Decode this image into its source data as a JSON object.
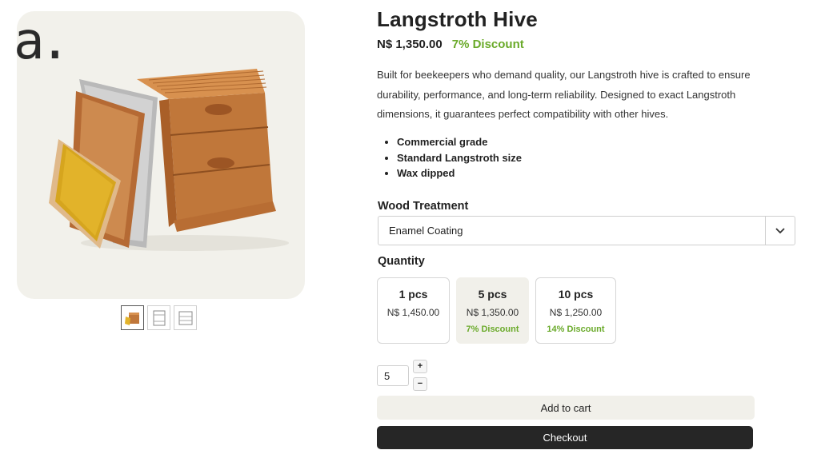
{
  "brand": {
    "mark": "a."
  },
  "gallery": {
    "main_image_alt": "Langstroth Hive",
    "thumbnails": [
      {
        "icon": "hive-thumb-icon",
        "active": true
      },
      {
        "icon": "frame-outline-thumb-icon",
        "active": false
      },
      {
        "icon": "box-outline-thumb-icon",
        "active": false
      }
    ]
  },
  "product": {
    "title": "Langstroth Hive",
    "price": "N$ 1,350.00",
    "discount": "7% Discount",
    "description": "Built for beekeepers who demand quality, our Langstroth hive is crafted to ensure durability, performance, and long-term reliability. Designed to exact Langstroth dimensions, it guarantees perfect compatibility with other hives.",
    "features": [
      "Commercial grade",
      "Standard Langstroth size",
      "Wax dipped"
    ]
  },
  "wood_treatment": {
    "label": "Wood Treatment",
    "selected": "Enamel Coating",
    "icon": "chevron-down-icon"
  },
  "quantity": {
    "label": "Quantity",
    "options": [
      {
        "pcs": "1 pcs",
        "price": "N$ 1,450.00",
        "discount": "",
        "selected": false
      },
      {
        "pcs": "5 pcs",
        "price": "N$ 1,350.00",
        "discount": "7% Discount",
        "selected": true
      },
      {
        "pcs": "10 pcs",
        "price": "N$ 1,250.00",
        "discount": "14% Discount",
        "selected": false
      }
    ],
    "stepper": {
      "value": "5",
      "plus": "+",
      "minus": "−"
    }
  },
  "actions": {
    "add_to_cart": "Add to cart",
    "checkout": "Checkout"
  },
  "colors": {
    "accent_green": "#6aaa2a",
    "panel_beige": "#f1f0ea",
    "checkout_dark": "#262626"
  }
}
